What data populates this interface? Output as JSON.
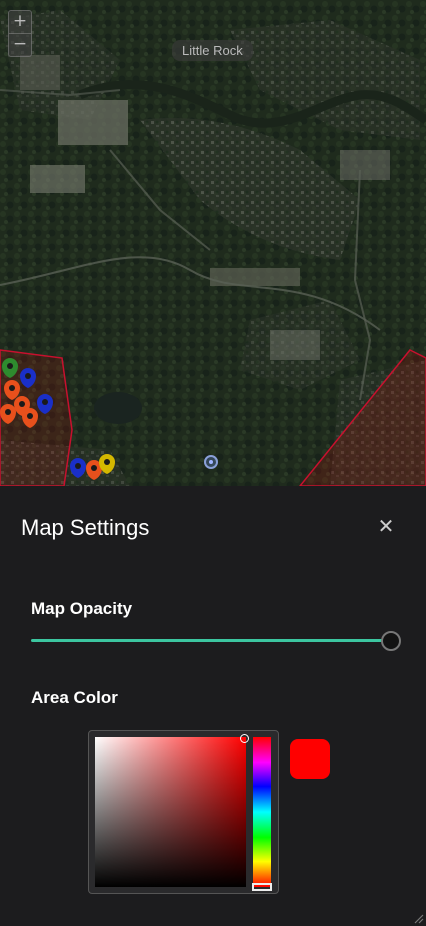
{
  "map": {
    "zoom_in_label": "+",
    "zoom_out_label": "−",
    "city_label": "Little Rock",
    "area_color": "#ff0000",
    "marker_colors": [
      "#2e8b2e",
      "#e8501c",
      "#1a2fc8",
      "#d4b800"
    ]
  },
  "panel": {
    "title": "Map Settings",
    "close_label": "✕",
    "opacity": {
      "label": "Map Opacity",
      "value": 1.0,
      "accent": "#3cc6a0"
    },
    "area_color": {
      "label": "Area Color",
      "value": "#ff0000"
    }
  }
}
